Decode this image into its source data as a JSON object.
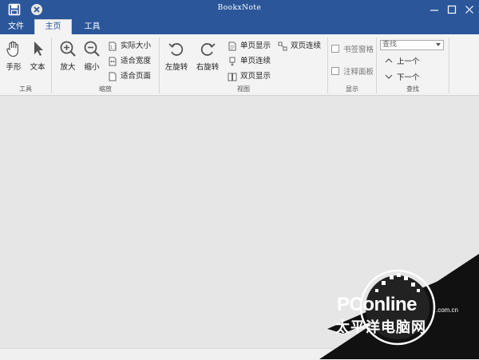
{
  "app": {
    "title": "BookxNote"
  },
  "tabs": [
    {
      "label": "文件",
      "active": false
    },
    {
      "label": "主页",
      "active": true
    },
    {
      "label": "工具",
      "active": false
    }
  ],
  "groups": {
    "tools": {
      "label": "工具",
      "hand": "手形",
      "text": "文本"
    },
    "zoom": {
      "label": "缩放",
      "zoom_in": "放大",
      "zoom_out": "缩小",
      "actual_size": "实际大小",
      "fit_width": "适合宽度",
      "fit_page": "适合页面"
    },
    "view": {
      "label": "视图",
      "rotate_left": "左旋转",
      "rotate_right": "右旋转",
      "single_page": "单页显示",
      "single_continuous": "单页连续",
      "double_page": "双页显示",
      "double_continuous": "双页连续"
    },
    "display": {
      "label": "显示",
      "bookmark_pane": "书签窗格",
      "annotation_panel": "注释面板"
    },
    "find": {
      "label": "查找",
      "search_placeholder": "查找",
      "prev": "上一个",
      "next": "下一个"
    }
  },
  "colors": {
    "titlebar": "#2b579a",
    "ribbon": "#f3f3f3",
    "workarea": "#e6e6e6"
  },
  "watermark": {
    "brand": "PConline",
    "domain": ".com.cn",
    "chinese": "太平洋电脑网"
  }
}
